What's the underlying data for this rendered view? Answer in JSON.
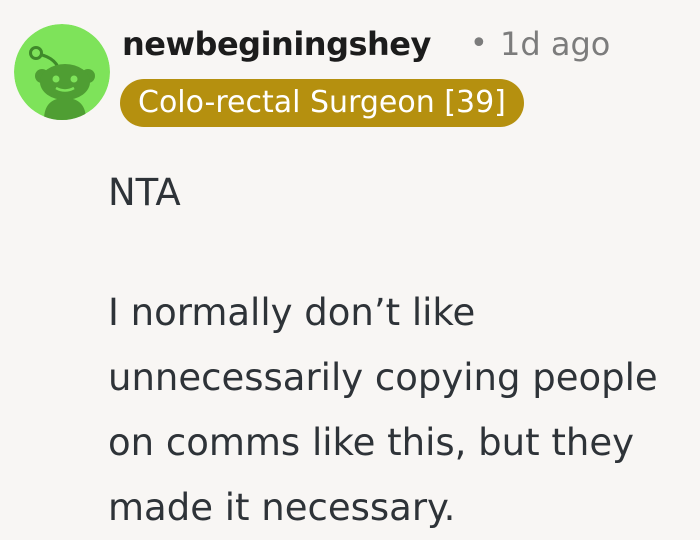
{
  "comment": {
    "username": "newbeginingshey",
    "separator": "•",
    "timestamp": "1d ago",
    "flair": "Colo-rectal Surgeon [39]",
    "flair_color": "#b5900f",
    "avatar_icon": "reddit-snoo-avatar-icon",
    "avatar_color": "#7ee35a",
    "paragraphs": [
      "NTA",
      "I normally don’t like unnecessarily copying people on comms like this, but they made it necessary."
    ]
  }
}
